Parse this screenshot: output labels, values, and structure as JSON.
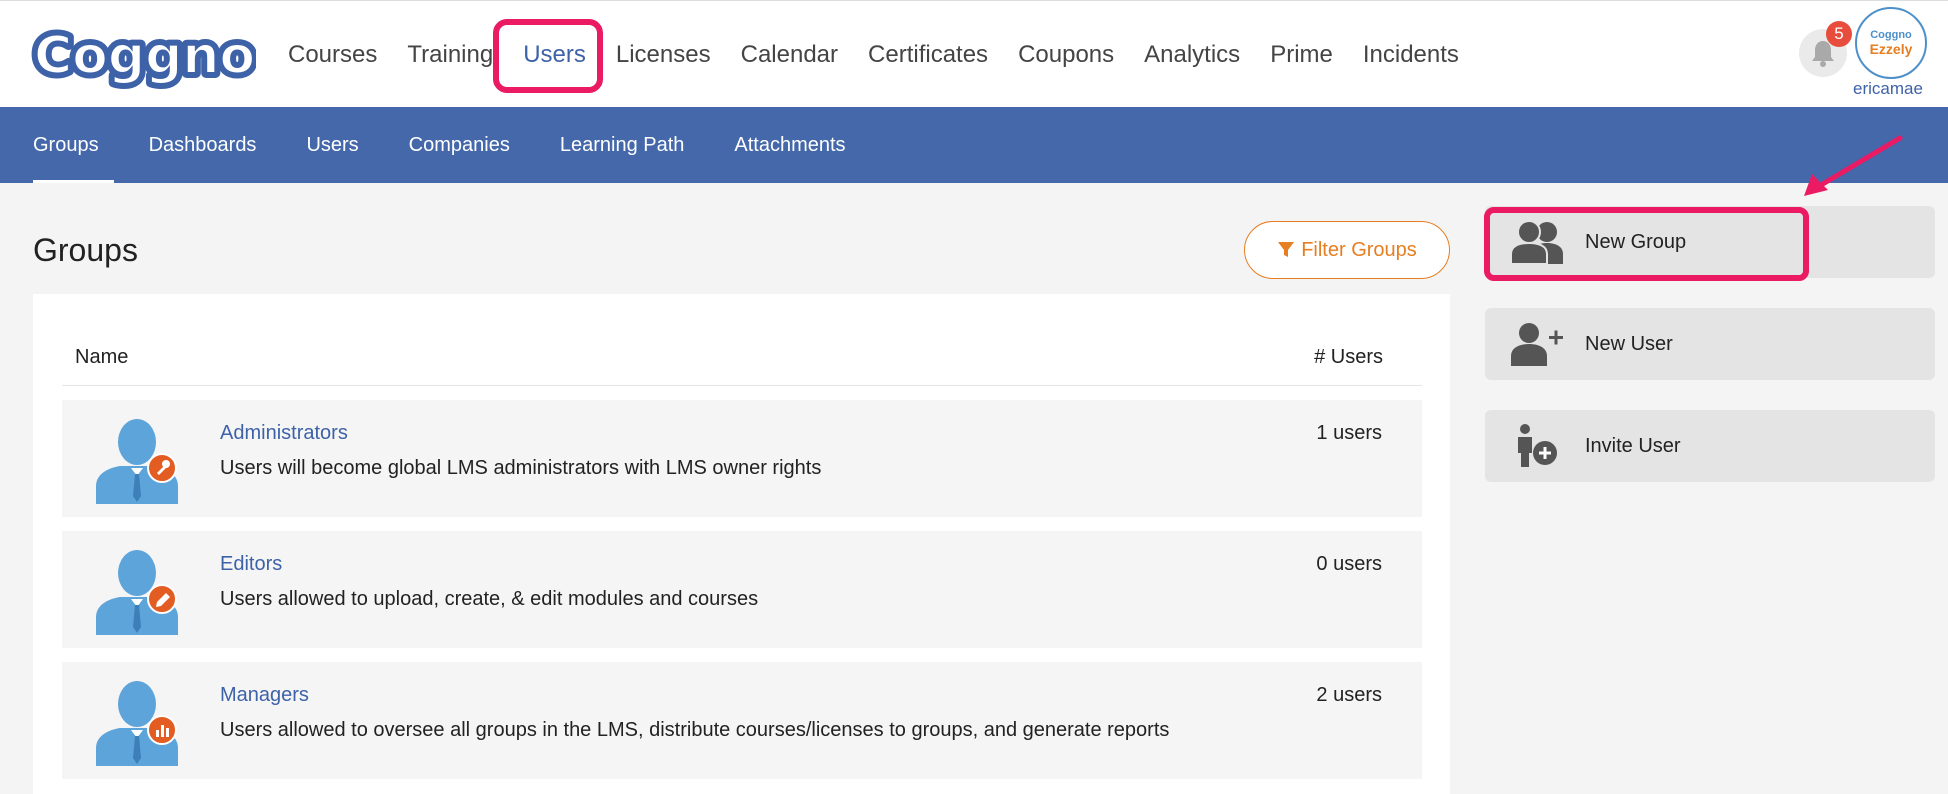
{
  "logo": {
    "text": "Coggno"
  },
  "nav": {
    "items": [
      "Courses",
      "Training",
      "Users",
      "Licenses",
      "Calendar",
      "Certificates",
      "Coupons",
      "Analytics",
      "Prime",
      "Incidents"
    ],
    "active": "Users"
  },
  "notifications": {
    "count": "5",
    "icon": "bell-icon"
  },
  "user": {
    "avatar_line1": "Coggno",
    "avatar_line2": "Ezzely",
    "name": "ericamae"
  },
  "subnav": {
    "items": [
      "Groups",
      "Dashboards",
      "Users",
      "Companies",
      "Learning Path",
      "Attachments"
    ],
    "active": "Groups"
  },
  "main": {
    "title": "Groups",
    "filter_label": "Filter Groups",
    "table": {
      "col_name": "Name",
      "col_users": "# Users",
      "rows": [
        {
          "name": "Administrators",
          "description": "Users will become global LMS administrators with LMS owner rights",
          "count": "1 users",
          "badge_icon": "key-icon"
        },
        {
          "name": "Editors",
          "description": "Users allowed to upload, create, & edit modules and courses",
          "count": "0 users",
          "badge_icon": "pencil-icon"
        },
        {
          "name": "Managers",
          "description": "Users allowed to oversee all groups in the LMS, distribute courses/licenses to groups, and generate reports",
          "count": "2 users",
          "badge_icon": "chart-icon"
        }
      ]
    }
  },
  "actions": {
    "new_group": "New Group",
    "new_user": "New User",
    "invite_user": "Invite User"
  },
  "colors": {
    "brand_blue": "#4468aa",
    "accent_orange": "#e67e22",
    "highlight_pink": "#ea1a63"
  }
}
